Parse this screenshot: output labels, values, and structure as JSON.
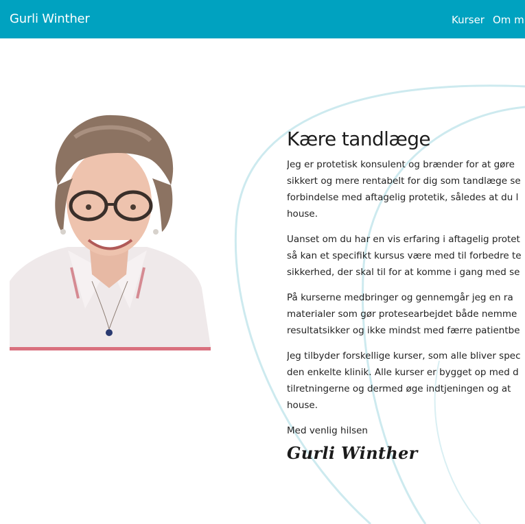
{
  "nav": {
    "brand": "Gurli Winther",
    "links": [
      {
        "label": "Kurser"
      },
      {
        "label": "Om mi"
      }
    ]
  },
  "colors": {
    "navbar": "#00a2c0",
    "accent_bar": "#d9707e",
    "wave": "#cbe9ee"
  },
  "portrait": {
    "icon": "portrait-photo"
  },
  "main": {
    "heading": "Kære tandlæge",
    "paragraphs": [
      {
        "lines": [
          "Jeg er protetisk konsulent og brænder for at gøre",
          "sikkert og mere rentabelt for dig som tandlæge se",
          "forbindelse med aftagelig protetik, således at du l",
          "house."
        ]
      },
      {
        "lines": [
          "Uanset om du har en vis erfaring i aftagelig protet",
          "så kan et specifikt kursus være med til forbedre te",
          "sikkerhed, der skal til for at komme i gang med se"
        ]
      },
      {
        "lines": [
          "På kurserne medbringer og gennemgår jeg en ra",
          "materialer som gør protesearbejdet både nemme",
          "resultatsikker og ikke mindst med færre patientbe"
        ]
      },
      {
        "lines": [
          "Jeg tilbyder forskellige kurser, som alle bliver spec",
          "den enkelte klinik. Alle kurser er bygget op med d",
          "tilretningerne og dermed øge indtjeningen og at",
          "house."
        ]
      }
    ],
    "greeting": "Med venlig hilsen",
    "signature": "Gurli Winther"
  }
}
